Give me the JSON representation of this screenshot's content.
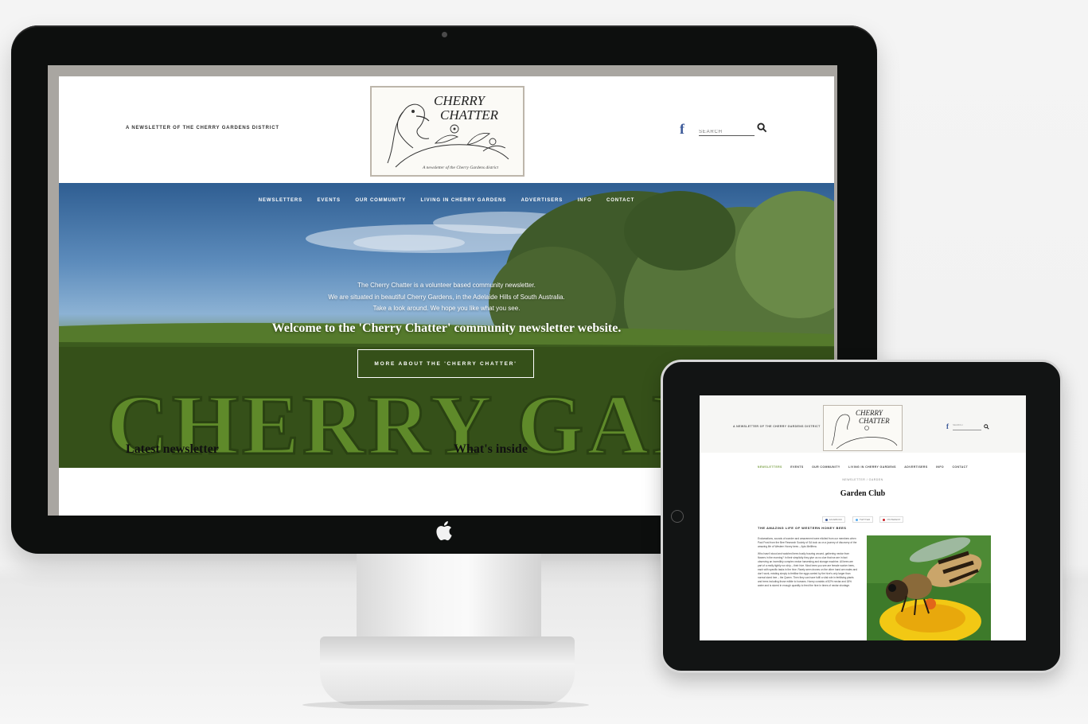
{
  "desktop": {
    "tagline": "A NEWSLETTER OF THE CHERRY GARDENS DISTRICT",
    "logo": {
      "line1": "CHERRY",
      "line2": "CHATTER",
      "subtitle": "A newsletter of the Cherry Gardens district"
    },
    "facebook_glyph": "f",
    "search": {
      "placeholder": "SEARCH"
    },
    "nav": [
      "NEWSLETTERS",
      "EVENTS",
      "OUR COMMUNITY",
      "LIVING IN CHERRY GARDENS",
      "ADVERTISERS",
      "INFO",
      "CONTACT"
    ],
    "intro_lines": [
      "The Cherry Chatter is a volunteer based community newsletter.",
      "We are situated in beautiful Cherry Gardens, in the Adelaide Hills of South Australia.",
      "Take a look around. We hope you like what you see."
    ],
    "welcome": "Welcome to the 'Cherry Chatter' community newsletter website.",
    "more_button": "MORE ABOUT THE 'CHERRY CHATTER'",
    "hedge_text": "CHERRY GAR",
    "sections": {
      "latest": "Latest newsletter",
      "inside": "What's inside"
    }
  },
  "tablet": {
    "tagline": "A NEWSLETTER OF THE CHERRY GARDENS DISTRICT",
    "search_placeholder": "SEARCH",
    "nav": [
      "NEWSLETTERS",
      "EVENTS",
      "OUR COMMUNITY",
      "LIVING IN CHERRY GARDENS",
      "ADVERTISERS",
      "INFO",
      "CONTACT"
    ],
    "nav_active": "NEWSLETTERS",
    "breadcrumb": "NEWSLETTER / GARDEN",
    "title": "Garden Club",
    "share": [
      {
        "label": "FACEBOOK",
        "color": "#3b5998"
      },
      {
        "label": "TWITTER",
        "color": "#55acee"
      },
      {
        "label": "PINTEREST",
        "color": "#cb2027"
      }
    ],
    "article_heading": "THE AMAZING LIFE OF WESTERN HONEY BEES",
    "paragraphs": [
      "Exclamations, sounds of wonder and amazement were elicited from our members when Paul Frost from the Bee Research Society of SA took us on a journey of discovery of the amazing life of Western Honey bees – Apis Mellifera.",
      "Who hasn't stood and watched bees busily buzzing around, gathering nectar from flowers in the morning? In their simplicity they give us no clue that we are in fact observing an incredibly complex nectar harvesting and storage machine. All bees are part of a really tightly run ship – their hive. Most bees you see are female worker bees, each with specific tasks in the hive. Rarely seen drones on the other hand are males and don't work, existing simply to fertilise the eggs carried by the hive's only larger than normal sized bee – the Queen. Then they can have fulfil a vital role in fertilising plants and trees including those edible to humans. Honey consists of 82% nectar and 18% water and is stored in enough quantity to feed the hive in times of nectar shortage."
    ]
  },
  "colors": {
    "monitor_bezel": "#0d0f0e",
    "facebook": "#3b5998",
    "active_nav": "#7ea24a"
  }
}
